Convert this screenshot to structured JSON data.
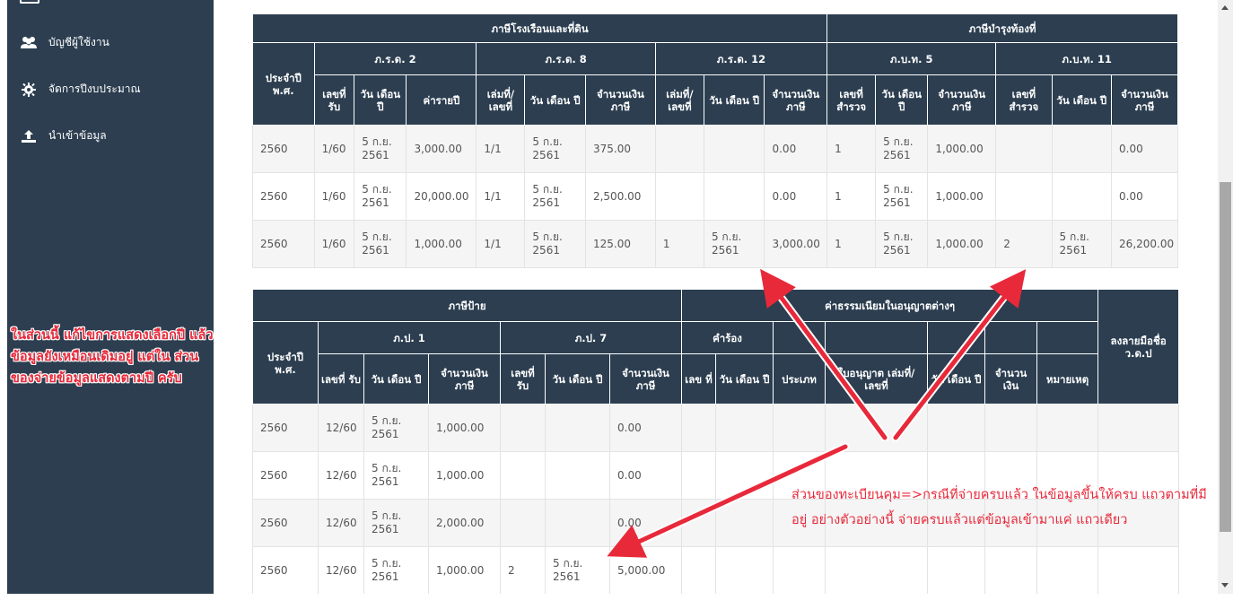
{
  "sidebar": {
    "items": [
      {
        "icon": "users-icon",
        "label": "บัญชีผู้ใช้งาน"
      },
      {
        "icon": "gear-icon",
        "label": "จัดการปีงบประมาณ"
      },
      {
        "icon": "upload-icon",
        "label": "นำเข้าข้อมูล"
      }
    ]
  },
  "annotations": {
    "left": "ในส่วนนี้ แก้ไขการแสดงเลือกปี แล้ว ข้อมูลยังเหมือนเดิมอยู่ แต่ใน ส่วนของจ่ายข้อมูลแสดงตามปี ครับ",
    "right": "ส่วนของทะเบียนคุม=>กรณีที่จ่ายครบแล้ว ในข้อมูลขึ้นให้ครบ แถวตามที่มีอยู่ อย่างตัวอย่างนี้ จ่ายครบแล้วแต่ข้อมูลเข้ามาแค่ แถวเดียว",
    "color": "#e8293a"
  },
  "table1": {
    "group1": "ภาษีโรงเรือนและที่ดิน",
    "group2": "ภาษีบำรุงท้องที่",
    "year_header": "ประจำปี พ.ศ.",
    "sub": [
      "ภ.ร.ด. 2",
      "ภ.ร.ด. 8",
      "ภ.ร.ด. 12",
      "ภ.บ.ท. 5",
      "ภ.บ.ท. 11"
    ],
    "cols": [
      "เลขที่ รับ",
      "วัน เดือน ปี",
      "ค่ารายปี",
      "เล่มที่/ เลขที่",
      "วัน เดือน ปี",
      "จำนวนเงิน ภาษี",
      "เล่มที่/ เลขที่",
      "วัน เดือน ปี",
      "จำนวนเงิน ภาษี",
      "เลขที่ สำรวจ",
      "วัน เดือน ปี",
      "จำนวนเงิน ภาษี",
      "เลขที่ สำรวจ",
      "วัน เดือน ปี",
      "จำนวนเงิน ภาษี"
    ],
    "rows": [
      [
        "2560",
        "1/60",
        "5 ก.ย. 2561",
        "3,000.00",
        "1/1",
        "5 ก.ย. 2561",
        "375.00",
        "",
        "",
        "0.00",
        "1",
        "5 ก.ย. 2561",
        "1,000.00",
        "",
        "",
        "0.00"
      ],
      [
        "2560",
        "1/60",
        "5 ก.ย. 2561",
        "20,000.00",
        "1/1",
        "5 ก.ย. 2561",
        "2,500.00",
        "",
        "",
        "0.00",
        "1",
        "5 ก.ย. 2561",
        "1,000.00",
        "",
        "",
        "0.00"
      ],
      [
        "2560",
        "1/60",
        "5 ก.ย. 2561",
        "1,000.00",
        "1/1",
        "5 ก.ย. 2561",
        "125.00",
        "1",
        "5 ก.ย. 2561",
        "3,000.00",
        "1",
        "5 ก.ย. 2561",
        "1,000.00",
        "2",
        "5 ก.ย. 2561",
        "26,200.00"
      ]
    ]
  },
  "table2": {
    "group1": "ภาษีป้าย",
    "group2": "ค่าธรรมเนียมในอนุญาตต่างๆ",
    "year_header": "ประจำปี พ.ศ.",
    "sub": [
      "ภ.ป. 1",
      "ภ.ป. 7",
      "คำร้อง"
    ],
    "cols": [
      "เลขที่ รับ",
      "วัน เดือน ปี",
      "จำนวนเงิน ภาษี",
      "เลขที่ รับ",
      "วัน เดือน ปี",
      "จำนวนเงิน ภาษี",
      "เลข ที่",
      "วัน เดือน ปี",
      "ประเภท",
      "ใบอนุญาต เล่มที่/ เลขที่",
      "วัน เดือน ปี",
      "จำนวน เงิน",
      "หมายเหตุ",
      "ลงลายมือชื่อ ว.ด.ป"
    ],
    "rows": [
      [
        "2560",
        "12/60",
        "5 ก.ย. 2561",
        "1,000.00",
        "",
        "",
        "0.00",
        "",
        "",
        "",
        "",
        "",
        "",
        "",
        ""
      ],
      [
        "2560",
        "12/60",
        "5 ก.ย. 2561",
        "1,000.00",
        "",
        "",
        "0.00",
        "",
        "",
        "",
        "",
        "",
        "",
        "",
        ""
      ],
      [
        "2560",
        "12/60",
        "5 ก.ย. 2561",
        "2,000.00",
        "",
        "",
        "0.00",
        "",
        "",
        "",
        "",
        "",
        "",
        "",
        ""
      ],
      [
        "2560",
        "12/60",
        "5 ก.ย. 2561",
        "1,000.00",
        "2",
        "5 ก.ย. 2561",
        "5,000.00",
        "",
        "",
        "",
        "",
        "",
        "",
        "",
        ""
      ]
    ]
  }
}
